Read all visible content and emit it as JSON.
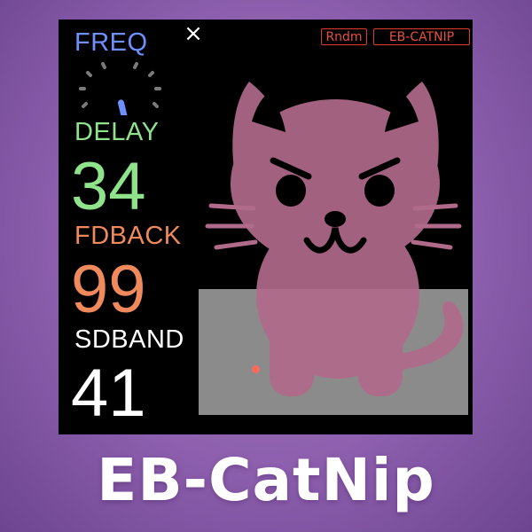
{
  "buttons": {
    "close": "×",
    "random": "Rndm",
    "preset": "EB-CATNIP"
  },
  "params": {
    "freq": {
      "label": "FREQ",
      "knob_level": 0.55
    },
    "delay": {
      "label": "DELAY",
      "value": "34"
    },
    "feedback": {
      "label": "FDBACK",
      "value": "99"
    },
    "sideband": {
      "label": "SDBAND",
      "value": "41"
    }
  },
  "banner": {
    "title": "EB-CatNip"
  },
  "colors": {
    "freq": "#6f90ff",
    "delay": "#8fe38b",
    "feedback": "#f08a5d",
    "sideband": "#ffffff",
    "cat": "#b06a8a",
    "pad": "#8b8b8b",
    "accent": "#e03a2e"
  },
  "icons": {
    "close": "close-icon",
    "mascot": "cat-mascot-icon"
  }
}
